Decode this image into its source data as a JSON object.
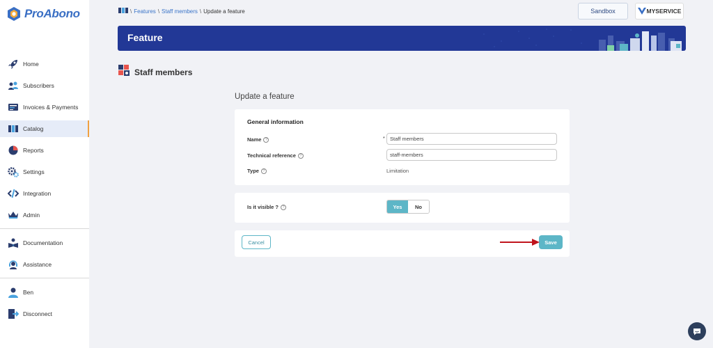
{
  "app": {
    "name": "ProAbono"
  },
  "sidebar": {
    "items": [
      {
        "label": "Home",
        "icon": "rocket-icon"
      },
      {
        "label": "Subscribers",
        "icon": "users-icon"
      },
      {
        "label": "Invoices & Payments",
        "icon": "invoice-icon"
      },
      {
        "label": "Catalog",
        "icon": "catalog-icon",
        "active": true
      },
      {
        "label": "Reports",
        "icon": "pie-chart-icon"
      },
      {
        "label": "Settings",
        "icon": "gears-icon"
      },
      {
        "label": "Integration",
        "icon": "code-icon"
      },
      {
        "label": "Admin",
        "icon": "crown-icon"
      }
    ],
    "help_items": [
      {
        "label": "Documentation",
        "icon": "book-icon"
      },
      {
        "label": "Assistance",
        "icon": "headset-icon"
      }
    ],
    "user_items": [
      {
        "label": "Ben",
        "icon": "user-icon"
      },
      {
        "label": "Disconnect",
        "icon": "exit-icon"
      }
    ]
  },
  "breadcrumb": {
    "items": [
      "Features",
      "Staff members"
    ],
    "current": "Update a feature",
    "separator": "\\"
  },
  "header": {
    "sandbox_label": "Sandbox",
    "brand_label": "MYSERVICE"
  },
  "banner": {
    "title": "Feature"
  },
  "section": {
    "title": "Staff members"
  },
  "form": {
    "title": "Update a feature",
    "general": {
      "heading": "General information",
      "name_label": "Name",
      "name_required_mark": "*",
      "name_value": "Staff members",
      "techref_label": "Technical reference",
      "techref_value": "staff-members",
      "type_label": "Type",
      "type_value": "Limitation"
    },
    "visibility": {
      "label": "Is it visible ?",
      "yes": "Yes",
      "no": "No",
      "selected": "Yes"
    },
    "actions": {
      "cancel": "Cancel",
      "save": "Save"
    }
  },
  "colors": {
    "brand_blue": "#223896",
    "accent_teal": "#5db6c7",
    "arrow_red": "#c0141c",
    "active_marker": "#f0a040"
  }
}
